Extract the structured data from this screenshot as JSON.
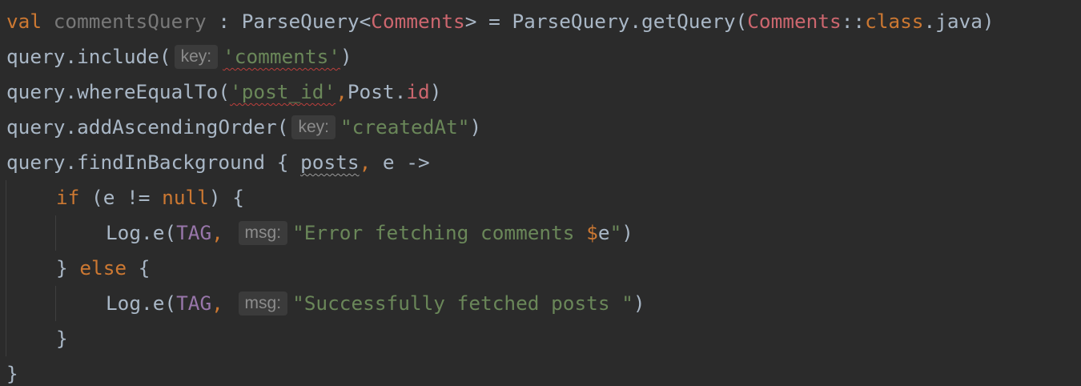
{
  "code": {
    "line1": {
      "kw_val": "val",
      "var_name": "commentsQuery",
      "type_sep": " : ",
      "type_name": "ParseQuery",
      "lt": "<",
      "generic_arg": "Comments",
      "gt_assign": "> = ",
      "call": "ParseQuery.getQuery(",
      "class_ref": "Comments",
      "double_colon": "::",
      "kw_class": "class",
      "java_tail": ".java)"
    },
    "line2": {
      "call": "query.include(",
      "hint": "key:",
      "arg": "'comments'",
      "close": ")"
    },
    "line3": {
      "call": "query.whereEqualTo(",
      "arg1": "'post_id'",
      "comma": ",",
      "obj": "Post.",
      "prop": "id",
      "close": ")"
    },
    "line4": {
      "call": "query.addAscendingOrder(",
      "hint": "key:",
      "arg": "\"createdAt\"",
      "close": ")"
    },
    "line5": {
      "call": "query.findInBackground { ",
      "param1": "posts",
      "comma": ",",
      "rest": " e ->"
    },
    "line6": {
      "kw_if": "if",
      "cond_open": " (e != ",
      "kw_null": "null",
      "cond_close": ") {"
    },
    "line7": {
      "call": "Log.e(",
      "tag": "TAG",
      "comma": ",",
      "hint": "msg:",
      "str_open": "\"Error fetching comments ",
      "dollar": "$",
      "var": "e",
      "str_close": "\"",
      "close": ")"
    },
    "line8": {
      "brace": "} ",
      "kw_else": "else",
      "open": " {"
    },
    "line9": {
      "call": "Log.e(",
      "tag": "TAG",
      "comma": ",",
      "hint": "msg:",
      "str": "\"Successfully fetched posts \"",
      "close": ")"
    },
    "line10": {
      "brace": "}"
    },
    "line11": {
      "brace": "}"
    }
  },
  "colors": {
    "background": "#2b2b2b",
    "keyword": "#cc7832",
    "string": "#6a8759",
    "type": "#cc666e",
    "constant": "#9876aa",
    "default_text": "#a9b7c6",
    "unused_var": "#787878",
    "hint_bg": "#3b3b3b",
    "hint_text": "#8c8c8c"
  }
}
